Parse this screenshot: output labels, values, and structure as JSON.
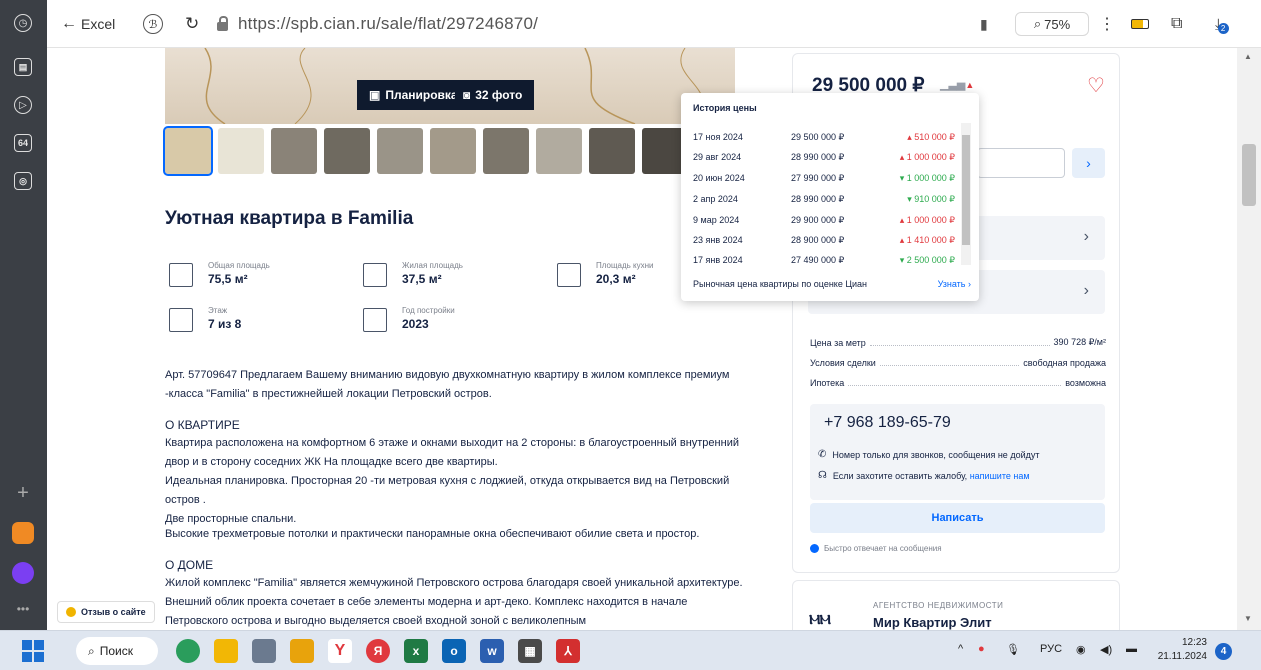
{
  "browser": {
    "back_label": "Excel",
    "url": "https://spb.cian.ru/sale/flat/297246870/",
    "zoom": "75%",
    "download_count": "2"
  },
  "hero": {
    "plan_label": "Планировка",
    "photos_label": "32 фото"
  },
  "listing": {
    "title": "Уютная квартира в Familia",
    "facts": [
      {
        "label": "Общая площадь",
        "value": "75,5 м²"
      },
      {
        "label": "Жилая площадь",
        "value": "37,5 м²"
      },
      {
        "label": "Площадь кухни",
        "value": "20,3 м²"
      },
      {
        "label": "Этаж",
        "value": "7 из 8"
      },
      {
        "label": "Год постройки",
        "value": "2023"
      }
    ],
    "intro": "Арт. 57709647 Предлагаем Вашему вниманию видовую двухкомнатную  квартиру  в жилом комплексе премиум -класса  \"Familia\" в престижнейшей локации Петровский остров.",
    "section1_title": "О КВАРТИРЕ",
    "section1_text": "Квартира расположена на комфортном 6 этаже и окнами выходит на 2 стороны: в благоустроенный внутренний двор и в сторону соседних ЖК  На площадке всего две квартиры.",
    "section1_line2": "Идеальная планировка. Просторная 20 -ти метровая кухня с лоджией, откуда открывается вид на Петровский остров .",
    "section1_line3": "Две просторные спальни.",
    "section1_line4": "Высокие трехметровые потолки и практически панорамные окна обеспечивают обилие света и простор.",
    "section2_title": "О ДОМЕ",
    "section2_text": "Жилой комплекс \"Familia\" является жемчужиной Петровского острова благодаря своей уникальной архитектуре. Внешний облик проекта сочетает в себе элементы модерна и арт-деко. Комплекс находится в начале Петровского острова и выгодно выделяется своей входной зоной с великолепным"
  },
  "review_button": "Отзыв о сайте",
  "sidebar_card": {
    "price": "29 500 000 ₽",
    "details": [
      {
        "key": "Цена за метр",
        "value": "390 728 ₽/м²"
      },
      {
        "key": "Условия сделки",
        "value": "свободная продажа"
      },
      {
        "key": "Ипотека",
        "value": "возможна"
      }
    ],
    "phone": "+7 968 189-65-79",
    "phone_note": "Номер только для звонков, сообщения не дойдут",
    "complaint_text": "Если захотите оставить жалобу,",
    "complaint_link": "напишите нам",
    "write_button": "Написать",
    "fast_reply": "Быстро отвечает на сообщения",
    "agency_type": "АГЕНТСТВО НЕДВИЖИМОСТИ",
    "agency_name": "Мир Квартир Элит"
  },
  "price_history": {
    "title": "История цены",
    "rows": [
      {
        "date": "17 ноя 2024",
        "price": "29 500 000 ₽",
        "change": "510 000 ₽",
        "dir": "up"
      },
      {
        "date": "29 авг 2024",
        "price": "28 990 000 ₽",
        "change": "1 000 000 ₽",
        "dir": "up"
      },
      {
        "date": "20 июн 2024",
        "price": "27 990 000 ₽",
        "change": "1 000 000 ₽",
        "dir": "down"
      },
      {
        "date": "2 апр 2024",
        "price": "28 990 000 ₽",
        "change": "910 000 ₽",
        "dir": "down"
      },
      {
        "date": "9 мар 2024",
        "price": "29 900 000 ₽",
        "change": "1 000 000 ₽",
        "dir": "up"
      },
      {
        "date": "23 янв 2024",
        "price": "28 900 000 ₽",
        "change": "1 410 000 ₽",
        "dir": "up"
      },
      {
        "date": "17 янв 2024",
        "price": "27 490 000 ₽",
        "change": "2 500 000 ₽",
        "dir": "down"
      }
    ],
    "footer_text": "Рыночная цена квартиры по оценке Циан",
    "footer_link": "Узнать"
  },
  "taskbar": {
    "search_label": "Поиск",
    "lang": "РУС",
    "time": "12:23",
    "date": "21.11.2024",
    "notifications": "4"
  },
  "colors": {
    "accent": "#0468ff",
    "price_up": "#e0393e",
    "price_down": "#2eab4f",
    "text": "#152242"
  }
}
